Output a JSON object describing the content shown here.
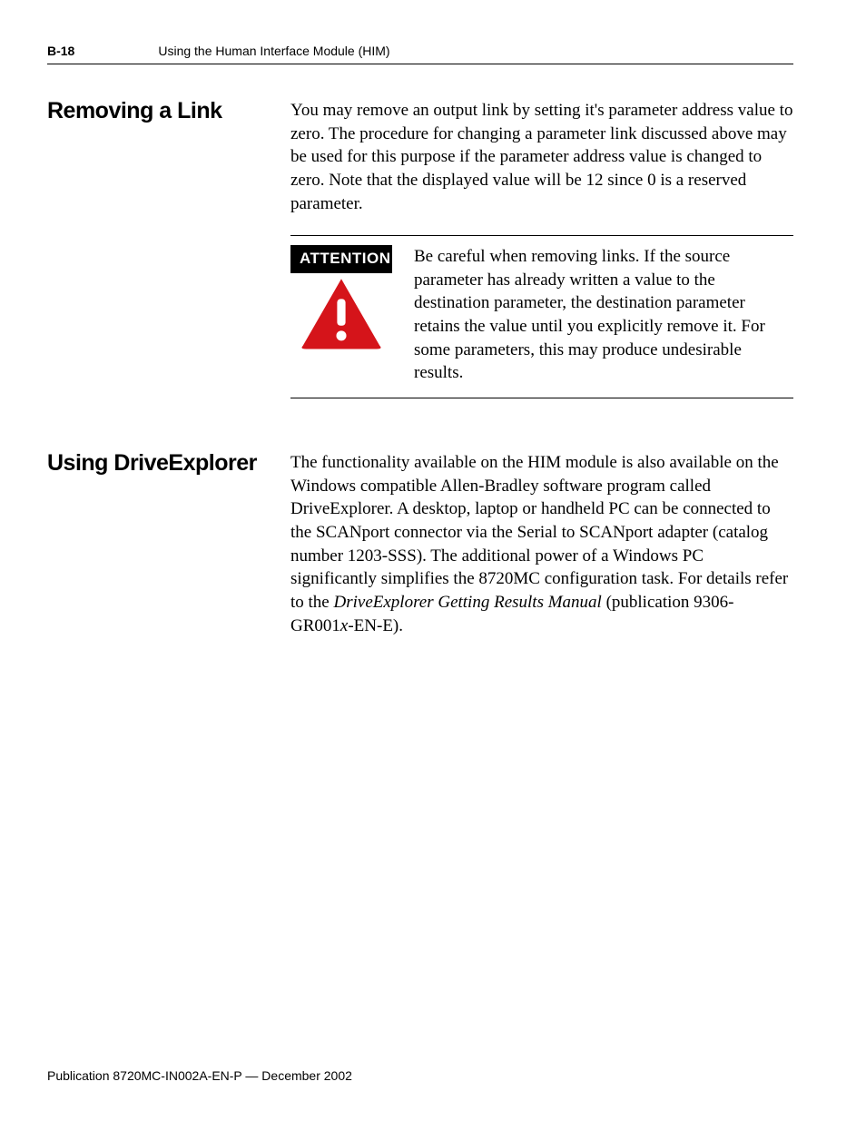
{
  "header": {
    "page_num": "B-18",
    "title": "Using the Human Interface Module (HIM)"
  },
  "section1": {
    "heading": "Removing a Link",
    "para": "You may remove an output link by setting it's parameter address value to zero. The procedure for changing a parameter link discussed above may be used for this purpose if the parameter address value is changed to zero. Note that the displayed value will be 12 since 0 is a reserved parameter.",
    "attention_label": "ATTENTION",
    "callout": "Be careful when removing links. If the source parameter has already written a value to the destination parameter, the destination parameter retains the value until you explicitly remove it. For some parameters, this may produce undesirable results."
  },
  "section2": {
    "heading": "Using DriveExplorer",
    "para_pre": "The functionality available on the HIM module is also available on the Windows compatible Allen-Bradley software program called DriveExplorer. A desktop, laptop or handheld PC can be connected to the SCANport connector via the Serial to SCANport adapter (catalog number 1203-SSS). The additional power of a Windows PC significantly simplifies the 8720MC configuration task. For details refer to the ",
    "manual_title": "DriveExplorer Getting Results Manual",
    "para_mid": " (publication 9306-GR001",
    "italic_x": "x",
    "para_post": "-EN-E)."
  },
  "footer": "Publication 8720MC-IN002A-EN-P — December 2002"
}
